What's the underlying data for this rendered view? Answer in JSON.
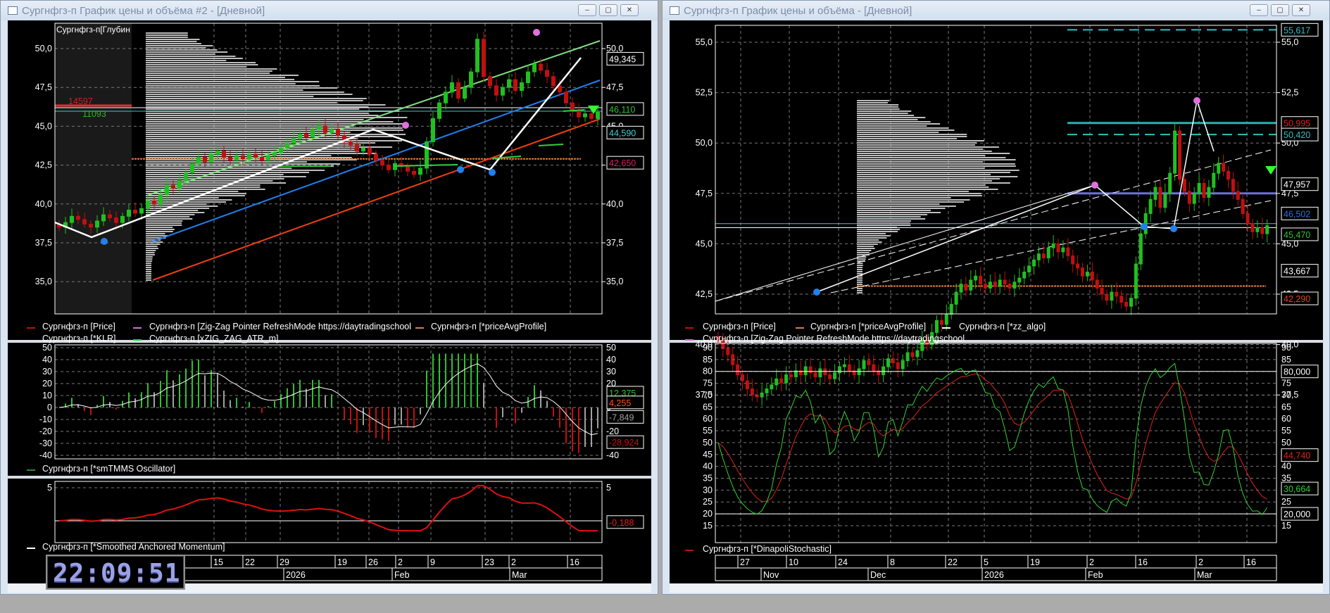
{
  "windows": {
    "left": {
      "title": "Сургнфгз-п График цены и объёма #2 - [Дневной]"
    },
    "right": {
      "title": "Сургнфгз-п График цены и объёма - [Дневной]"
    },
    "buttons": {
      "minimize": "–",
      "maximize": "▢",
      "close": "✕"
    }
  },
  "left": {
    "depth_label": "Сургнфгз-п[Глубин",
    "depth_ask": "14597",
    "depth_bid": "11093",
    "price_legend": [
      {
        "text": "Сургнфгз-п [Price]",
        "color": "#c01010"
      },
      {
        "text": "Сургнфгз-п [Zig-Zag Pointer RefreshMode https://daytradingschool",
        "color": "#d070d0"
      },
      {
        "text": "Сургнфгз-п [*priceAvgProfile]",
        "color": "#d08050"
      },
      {
        "text": "Сургнфгз-п [*KLR]",
        "color": "#000000"
      },
      {
        "text": "Сургнфгз-п [xZIG_ZAG_ATR_m]",
        "color": "#30d040"
      }
    ],
    "osc_legend": {
      "text": "Сургнфгз-п [*smTMMS Oscillator]",
      "color": "#2a8a2a"
    },
    "mom_legend": {
      "text": "Сургнфгз-п [*Smoothed Anchored Momentum]",
      "color": "#ffffff"
    },
    "time_days": [
      "15",
      "22",
      "29",
      "19",
      "26",
      "2",
      "9",
      "23",
      "2",
      "16"
    ],
    "time_months": [
      "2026",
      "Feb",
      "Mar"
    ],
    "clock": "22:09:51"
  },
  "right": {
    "price_legend": [
      {
        "text": "Сургнфгз-п [Price]",
        "color": "#c01010"
      },
      {
        "text": "Сургнфгз-п [*priceAvgProfile]",
        "color": "#d08050"
      },
      {
        "text": "Сургнфгз-п [*zz_algo]",
        "color": "#ffffff"
      },
      {
        "text": "Сургнфгз-п [Zig-Zag Pointer RefreshMode https://daytradingschool",
        "color": "#d070d0"
      }
    ],
    "stoch_legend": {
      "text": "Сургнфгз-п [*DinapoliStochastic]",
      "color": "#c01010"
    },
    "time_days": [
      "27",
      "10",
      "24",
      "8",
      "22",
      "5",
      "19",
      "2",
      "16",
      "2",
      "16"
    ],
    "time_months": [
      "Nov",
      "Dec",
      "2026",
      "Feb",
      "Mar"
    ]
  },
  "chart_data": [
    {
      "type": "candlestick",
      "title": "Сургнфгз-п Price (daily)",
      "closes": [
        40.2,
        39.8,
        39.5,
        39.0,
        38.5,
        38.2,
        37.8,
        37.5,
        37.4,
        37.6,
        37.8,
        38.0,
        38.3,
        38.1,
        38.5,
        38.4,
        38.7,
        38.5,
        38.9,
        38.6,
        38.4,
        38.8,
        38.5,
        38.3,
        38.6,
        38.9,
        39.0,
        38.7,
        38.5,
        38.8,
        39.2,
        39.0,
        38.7,
        38.5,
        38.9,
        39.3,
        39.1,
        38.8,
        39.2,
        39.6,
        39.4,
        39.7,
        40.2,
        40.0,
        40.6,
        41.2,
        41.0,
        41.5,
        42.0,
        42.6,
        43.0,
        42.7,
        43.2,
        43.4,
        43.0,
        42.8,
        43.1,
        42.9,
        43.2,
        43.0,
        42.8,
        43.1,
        43.3,
        43.6,
        43.9,
        44.2,
        44.5,
        44.3,
        44.8,
        45.0,
        44.6,
        44.8,
        44.4,
        44.0,
        43.8,
        43.4,
        43.6,
        43.2,
        42.8,
        42.5,
        42.2,
        42.6,
        42.4,
        42.1,
        41.9,
        42.3,
        44.0,
        45.5,
        46.5,
        47.2,
        47.8,
        46.8,
        47.5,
        48.5,
        50.6,
        48.2,
        47.6,
        47.0,
        47.5,
        48.0,
        47.3,
        47.8,
        48.5,
        49.0,
        48.6,
        48.2,
        47.6,
        47.2,
        46.5,
        46.0,
        45.6,
        45.8,
        45.5,
        45.9
      ],
      "left_chart_start_index": 28,
      "left_yticks": [
        "50,0",
        "47,5",
        "45,0",
        "42,5",
        "40,0",
        "37,5",
        "35,0"
      ],
      "left_yrange": [
        32.5,
        51.5
      ],
      "right_yticks": [
        "55,0",
        "52,5",
        "50,0",
        "47,5",
        "45,0",
        "42,5",
        "40,0",
        "37,5"
      ],
      "right_yrange": [
        36.5,
        56.5
      ],
      "left_value_tags": [
        {
          "value": 49.345,
          "text": "49,345",
          "color": "#ffffff"
        },
        {
          "value": 46.11,
          "text": "46,110",
          "color": "#30c030"
        },
        {
          "value": 44.59,
          "text": "44,590",
          "color": "#40d0d0"
        },
        {
          "value": 42.65,
          "text": "42,650",
          "color": "#d02060"
        }
      ],
      "right_value_tags": [
        {
          "value": 55.617,
          "text": "55,617",
          "color": "#30c0c0"
        },
        {
          "value": 50.995,
          "text": "50,995",
          "color": "#e02020"
        },
        {
          "value": 50.42,
          "text": "50,420",
          "color": "#30c0c0"
        },
        {
          "value": 47.957,
          "text": "47,957",
          "color": "#ffffff"
        },
        {
          "value": 46.502,
          "text": "46,502",
          "color": "#3070e0"
        },
        {
          "value": 45.47,
          "text": "45,470",
          "color": "#30c030"
        },
        {
          "value": 43.667,
          "text": "43,667",
          "color": "#ffffff"
        },
        {
          "value": 42.29,
          "text": "42,290",
          "color": "#e04020"
        }
      ],
      "price_avg_profile": 42.9
    },
    {
      "type": "bar",
      "title": "smTMMS Oscillator",
      "yticks": [
        "50",
        "40",
        "30",
        "20",
        "10",
        "0",
        "-10",
        "-20",
        "-30",
        "-40"
      ],
      "yrange": [
        -40,
        50
      ],
      "value_tags": [
        {
          "value": 12.375,
          "text": "12,375",
          "color": "#30c030"
        },
        {
          "value": 4.255,
          "text": "4,255",
          "color": "#ff5020"
        },
        {
          "value": -7.849,
          "text": "-7,849",
          "color": "#a0a0a0"
        },
        {
          "value": -28.924,
          "text": "-28,924",
          "color": "#c01010"
        }
      ]
    },
    {
      "type": "line",
      "title": "Smoothed Anchored Momentum",
      "yticks": [
        "5",
        "0"
      ],
      "value_tags": [
        {
          "value": -0.188,
          "text": "-0,188",
          "color": "#e02020"
        }
      ]
    },
    {
      "type": "line",
      "title": "DinapoliStochastic",
      "yticks": [
        "90",
        "85",
        "80",
        "75",
        "70",
        "65",
        "60",
        "55",
        "50",
        "45",
        "40",
        "35",
        "30",
        "25",
        "20",
        "15"
      ],
      "yrange": [
        12,
        90
      ],
      "levels": [
        80,
        20
      ],
      "value_tags": [
        {
          "value": 80,
          "text": "80,000",
          "color": "#ffffff"
        },
        {
          "value": 44.74,
          "text": "44,740",
          "color": "#e02020"
        },
        {
          "value": 30.664,
          "text": "30,664",
          "color": "#30d030"
        },
        {
          "value": 20,
          "text": "20,000",
          "color": "#ffffff"
        }
      ]
    }
  ]
}
